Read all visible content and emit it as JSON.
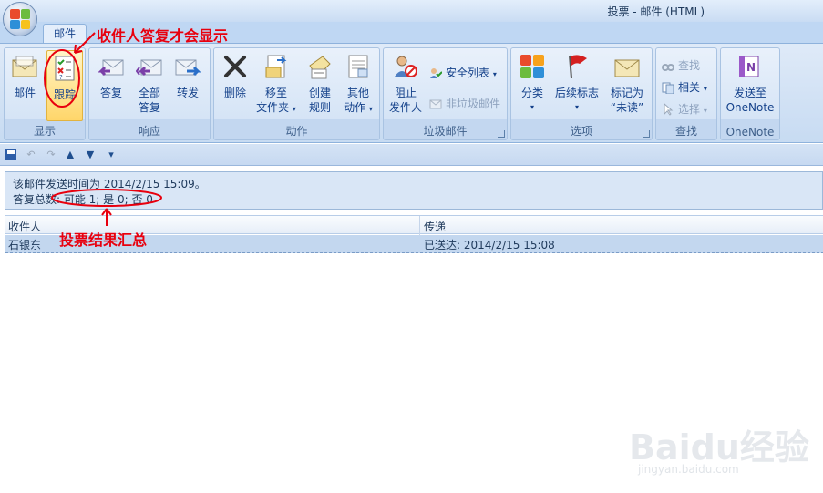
{
  "window": {
    "title": "投票 - 邮件 (HTML)"
  },
  "tabs": [
    {
      "label": "邮件"
    }
  ],
  "ribbon": {
    "groups": {
      "display": {
        "label": "显示",
        "buttons": {
          "mail": "邮件",
          "tracking": "跟踪"
        }
      },
      "respond": {
        "label": "响应",
        "buttons": {
          "reply": "答复",
          "reply_all_1": "全部",
          "reply_all_2": "答复",
          "forward": "转发"
        }
      },
      "actions": {
        "label": "动作",
        "buttons": {
          "delete": "删除",
          "move_1": "移至",
          "move_2": "文件夹",
          "rules_1": "创建",
          "rules_2": "规则",
          "other_1": "其他",
          "other_2": "动作"
        }
      },
      "junk": {
        "label": "垃圾邮件",
        "buttons": {
          "block_1": "阻止",
          "block_2": "发件人",
          "safe_lists": "安全列表",
          "not_junk": "非垃圾邮件"
        }
      },
      "options": {
        "label": "选项",
        "buttons": {
          "categorize": "分类",
          "follow_up": "后续标志",
          "mark_1": "标记为",
          "mark_2": "“未读”"
        }
      },
      "find": {
        "label": "查找",
        "buttons": {
          "find": "查找",
          "related": "相关",
          "select": "选择"
        }
      },
      "onenote": {
        "label": "OneNote",
        "buttons": {
          "send_1": "发送至",
          "send_2": "OneNote"
        }
      }
    }
  },
  "info": {
    "line1": "该邮件发送时间为 2014/2/15 15:09。",
    "line2": "答复总数: 可能 1; 是 0; 否 0"
  },
  "table": {
    "columns": [
      "收件人",
      "传递"
    ],
    "rows": [
      {
        "recipient": "石银东",
        "delivery": "已送达: 2014/2/15 15:08"
      }
    ]
  },
  "annotations": {
    "tracking_note": "收件人答复才会显示",
    "summary_note": "投票结果汇总"
  },
  "watermark": {
    "text": "Baidu经验",
    "url": "jingyan.baidu.com"
  },
  "colors": {
    "annotation": "#e8000e",
    "ribbon": "#c7dbf2",
    "selected_row": "#c3d7ef"
  }
}
